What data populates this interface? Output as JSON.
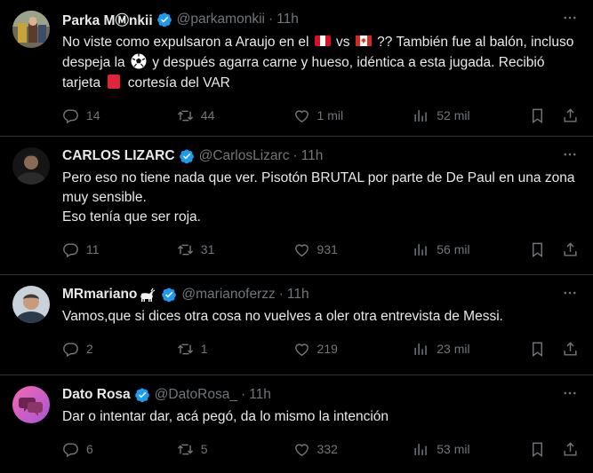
{
  "tweets": [
    {
      "name": "Parka MⓂnkii",
      "handle": "@parkamonkii",
      "time": "11h",
      "text_parts": [
        "No viste como expulsaron a Araujo en el ",
        " vs ",
        " ?? También fue al balón, incluso despeja la ",
        " y después agarra carne y hueso, idéntica a esta jugada. Recibió tarjeta ",
        " cortesía del VAR"
      ],
      "emojis": [
        "flag-peru-icon",
        "flag-canada-icon",
        "soccer-ball-icon",
        "red-card-icon"
      ],
      "replies": "14",
      "retweets": "44",
      "likes": "1 mil",
      "views": "52 mil"
    },
    {
      "name": "CARLOS LIZARC",
      "handle": "@CarlosLizarc",
      "time": "11h",
      "text": "Pero eso no tiene nada que ver. Pisotón BRUTAL por parte de De Paul en una zona muy sensible.\nEso tenía que ser roja.",
      "replies": "11",
      "retweets": "31",
      "likes": "931",
      "views": "56 mil"
    },
    {
      "name": "MRmariano",
      "name_emoji": "goat-icon",
      "handle": "@marianoferzz",
      "time": "11h",
      "text": "Vamos,que si dices otra cosa no vuelves a oler otra entrevista de Messi.",
      "replies": "2",
      "retweets": "1",
      "likes": "219",
      "views": "23 mil"
    },
    {
      "name": "Dato Rosa",
      "handle": "@DatoRosa_",
      "time": "11h",
      "text": "Dar o intentar dar, acá pegó, da lo mismo la intención",
      "replies": "6",
      "retweets": "5",
      "likes": "332",
      "views": "53 mil"
    }
  ],
  "dot": "·",
  "colors": {
    "background": "#000000",
    "text": "#e7e9ea",
    "muted": "#71767b",
    "verified": "#1d9bf0",
    "divider": "#2f3336"
  }
}
